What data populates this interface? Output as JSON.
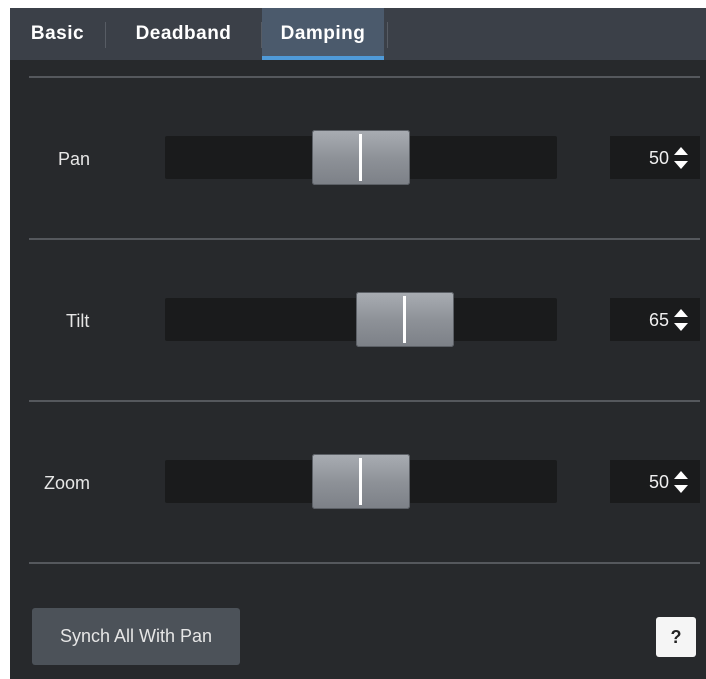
{
  "tabs": [
    {
      "label": "Basic",
      "active": false
    },
    {
      "label": "Deadband",
      "active": false
    },
    {
      "label": "Damping",
      "active": true
    }
  ],
  "rows": [
    {
      "label": "Pan",
      "value": "50",
      "position_percent": 50
    },
    {
      "label": "Tilt",
      "value": "65",
      "position_percent": 65
    },
    {
      "label": "Zoom",
      "value": "50",
      "position_percent": 50
    }
  ],
  "synch_button_label": "Synch All With Pan",
  "help_button_label": "?",
  "colors": {
    "panel_bg": "#27292c",
    "tabbar_bg": "#3b4048",
    "active_tab_bg": "#4b5a6c",
    "active_tab_underline": "#4f9ad8",
    "track_bg": "#1a1b1c"
  }
}
